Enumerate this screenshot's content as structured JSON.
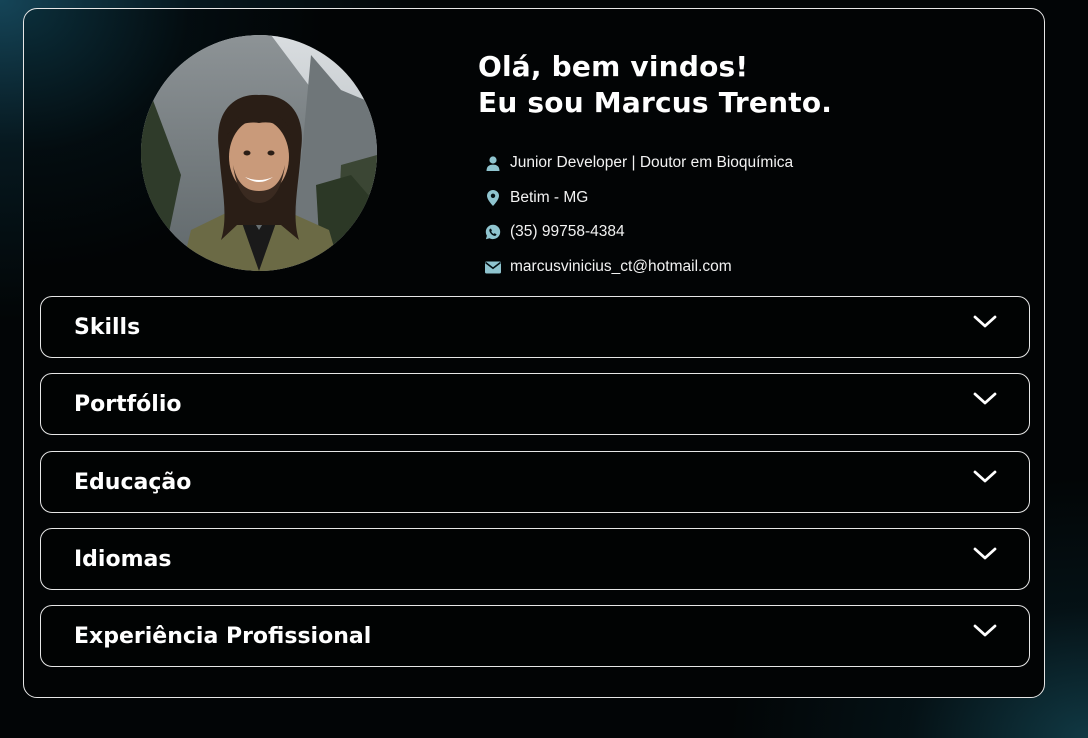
{
  "profile": {
    "greeting": "Olá, bem vindos!",
    "intro": "Eu sou Marcus Trento.",
    "photo_alt": "Marcus Trento"
  },
  "info": [
    {
      "icon": "user-icon",
      "text": "Junior Developer | Doutor em Bioquímica"
    },
    {
      "icon": "location-pin-icon",
      "text": "Betim - MG"
    },
    {
      "icon": "whatsapp-icon",
      "text": "(35) 99758-4384"
    },
    {
      "icon": "envelope-icon",
      "text": "marcusvinicius_ct@hotmail.com"
    }
  ],
  "sections": [
    {
      "label": "Skills"
    },
    {
      "label": "Portfólio"
    },
    {
      "label": "Educação"
    },
    {
      "label": "Idiomas"
    },
    {
      "label": "Experiência Profissional"
    }
  ],
  "colors": {
    "icon": "#8fc4cf",
    "border": "#e6e6e6",
    "text": "#ffffff",
    "background": "#020506"
  }
}
